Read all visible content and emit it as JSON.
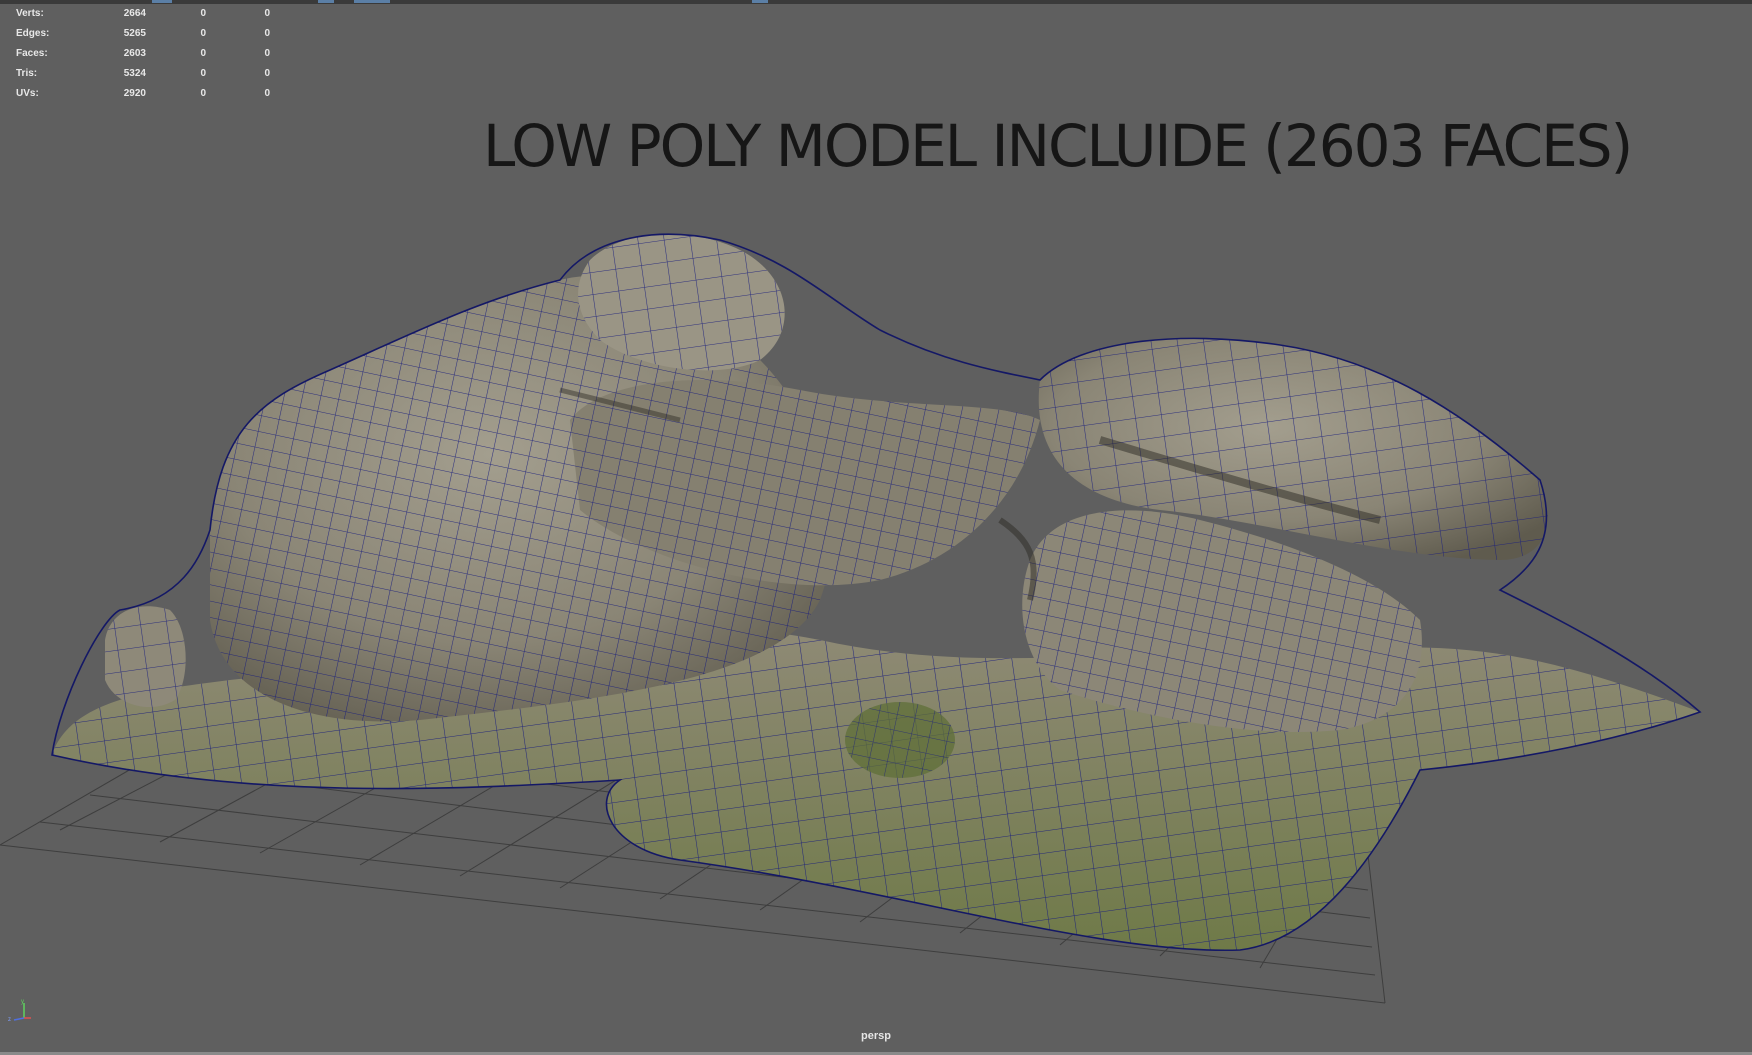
{
  "stats": [
    {
      "label": "Verts:",
      "value": "2664",
      "sel": "0",
      "tri": "0"
    },
    {
      "label": "Edges:",
      "value": "5265",
      "sel": "0",
      "tri": "0"
    },
    {
      "label": "Faces:",
      "value": "2603",
      "sel": "0",
      "tri": "0"
    },
    {
      "label": "Tris:",
      "value": "5324",
      "sel": "0",
      "tri": "0"
    },
    {
      "label": "UVs:",
      "value": "2920",
      "sel": "0",
      "tri": "0"
    }
  ],
  "headline": "LOW POLY MODEL INCLUIDE (2603 FACES)",
  "camera": "persp",
  "axis": {
    "x": "x",
    "y": "y",
    "z": "z"
  },
  "colors": {
    "viewport_bg": "#5f5f5f",
    "grid": "#3d3d3d",
    "wireframe": "#1a1f7a",
    "rock": "#8e8a7b",
    "moss": "#6f7a45"
  }
}
